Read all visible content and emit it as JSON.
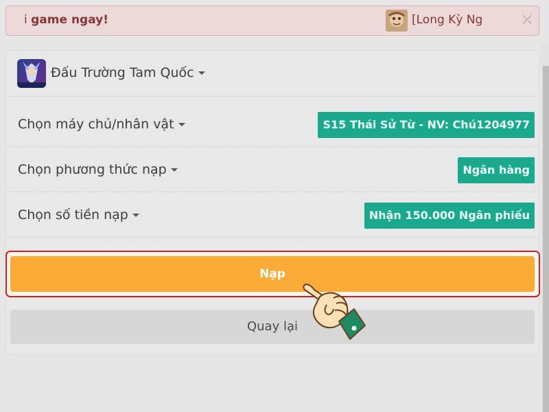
{
  "banner": {
    "text_prefix": "i",
    "text_bold": "game ngay!",
    "user": "[Long Kỳ Ng",
    "close": "×"
  },
  "game": {
    "name": "Đấu Trường Tam Quốc"
  },
  "options": [
    {
      "label": "Chọn máy chủ/nhân vật",
      "value": "S15 Thái Sử Từ - NV: Chú1204977"
    },
    {
      "label": "Chọn phương thức nạp",
      "value": "Ngân hàng"
    },
    {
      "label": "Chọn số tiền nạp",
      "value": "Nhận 150.000 Ngân phiếu"
    }
  ],
  "actions": {
    "submit_label": "Nạp",
    "back_label": "Quay lại"
  },
  "colors": {
    "accent_orange": "#fcab36",
    "value_teal": "#1aa98d",
    "highlight_red": "#cc1f1f"
  },
  "icons": {
    "pointer": "pointing-hand-icon",
    "close": "close-icon",
    "caret": "caret-down-icon"
  }
}
